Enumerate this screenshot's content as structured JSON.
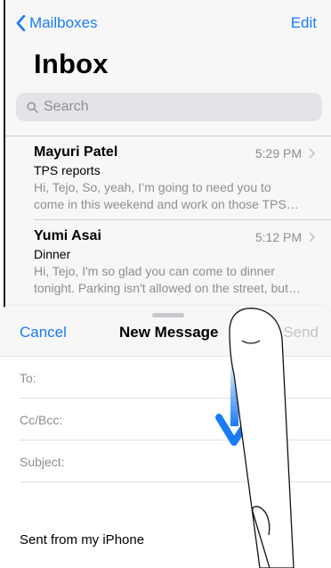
{
  "nav": {
    "back_label": "Mailboxes",
    "edit_label": "Edit"
  },
  "inbox": {
    "title": "Inbox",
    "search_placeholder": "Search"
  },
  "mails": [
    {
      "sender": "Mayuri Patel",
      "time": "5:29 PM",
      "subject": "TPS reports",
      "preview_line1": "Hi, Tejo, So, yeah, I’m going to need you to",
      "preview_line2": "come in this weekend and work on those TPS…"
    },
    {
      "sender": "Yumi Asai",
      "time": "5:12 PM",
      "subject": "Dinner",
      "preview_line1": "Hi, Tejo, I'm so glad you can come to dinner",
      "preview_line2": "tonight. Parking isn't allowed on the street, but…"
    }
  ],
  "compose": {
    "cancel_label": "Cancel",
    "title": "New Message",
    "send_label": "Send",
    "to_label": "To:",
    "ccbcc_label": "Cc/Bcc:",
    "subject_label": "Subject:",
    "signature": "Sent from my iPhone"
  },
  "colors": {
    "accent": "#1a7cf5",
    "gesture_arrow": "#1a7cf5"
  },
  "icons": {
    "back": "chevron-left-icon",
    "search": "magnifier-icon",
    "disclosure": "chevron-right-icon",
    "gesture": "swipe-down-arrow-icon"
  }
}
